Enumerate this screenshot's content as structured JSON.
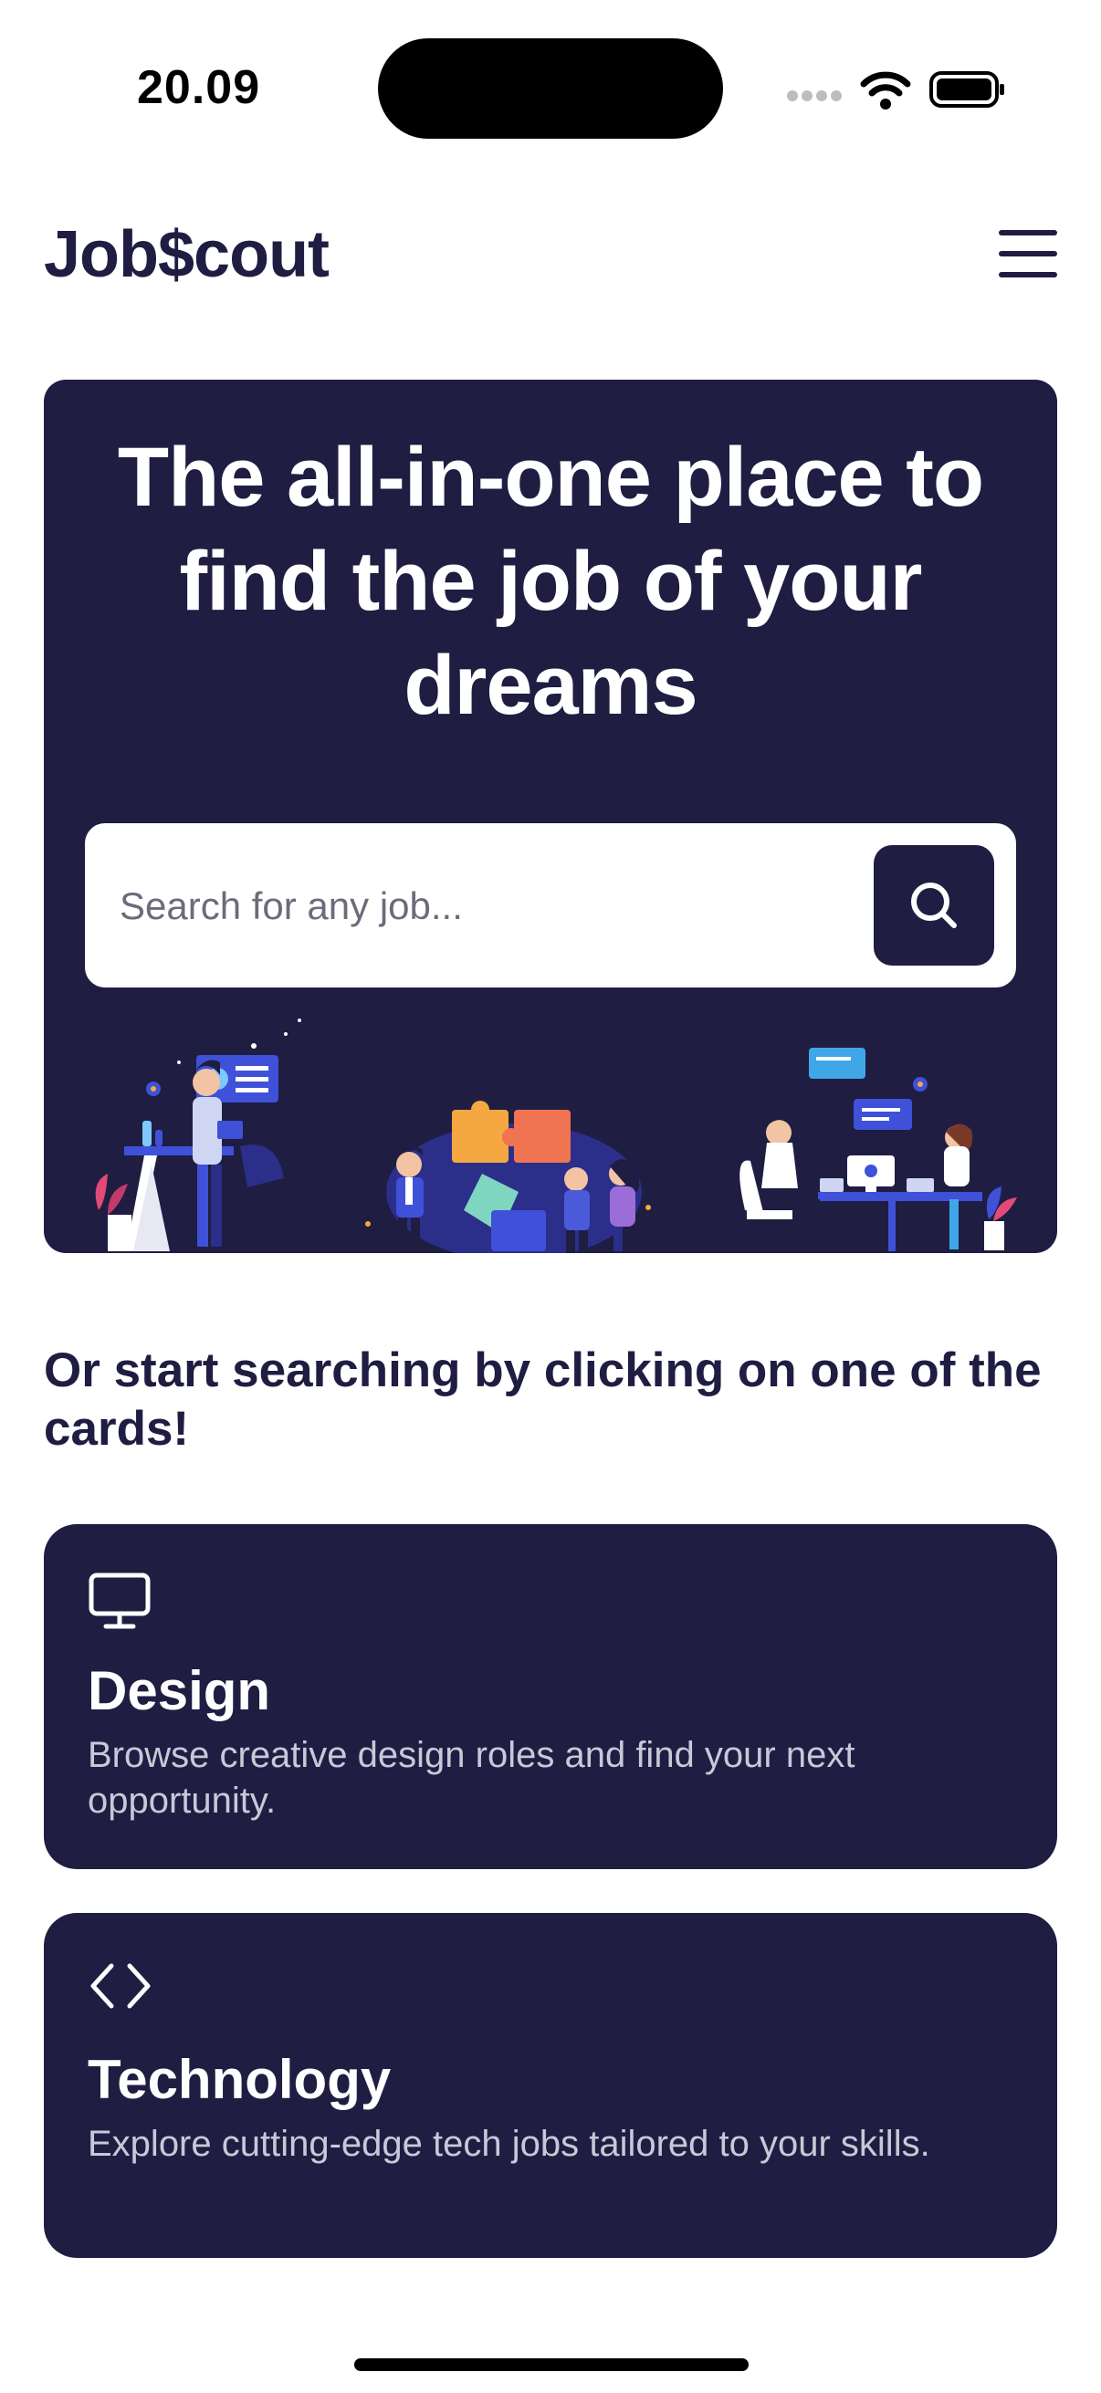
{
  "status_bar": {
    "time": "20.09"
  },
  "header": {
    "logo": "Job$cout"
  },
  "hero": {
    "title": "The all-in-one place to find the job of your dreams",
    "search": {
      "placeholder": "Search for any job...",
      "value": ""
    }
  },
  "subheading": "Or start searching by clicking on one of the cards!",
  "cards": [
    {
      "title": "Design",
      "description": "Browse creative design roles and find your next opportunity.",
      "icon": "monitor-icon"
    },
    {
      "title": "Technology",
      "description": "Explore cutting-edge tech jobs tailored to your skills.",
      "icon": "code-icon"
    }
  ],
  "colors": {
    "primary": "#1f1d42",
    "background": "#ffffff",
    "accent_orange": "#f5a742",
    "accent_blue": "#3f51d8"
  }
}
